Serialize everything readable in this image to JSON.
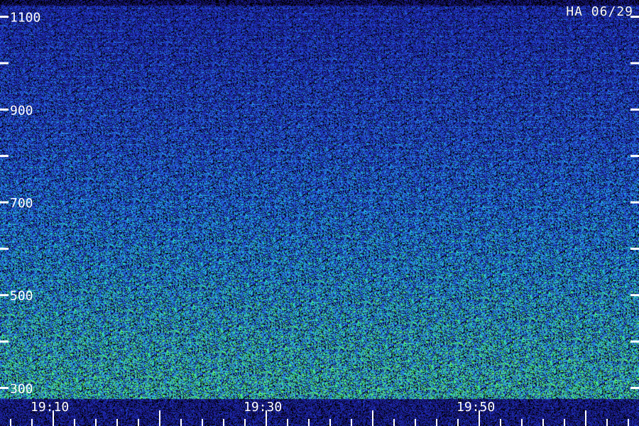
{
  "station_label": "HA 06/29",
  "chart_data": {
    "type": "heatmap",
    "title": "",
    "xlabel": "",
    "ylabel": "",
    "x_tick_labels": [
      "19:10",
      "19:30",
      "19:50"
    ],
    "x_ticks_minutes": [
      10,
      30,
      50
    ],
    "x_range_minutes": [
      5,
      65
    ],
    "x_minor_step_minutes": 2,
    "x_label_every_minutes": 20,
    "y_tick_labels": [
      "1100",
      "900",
      "700",
      "500",
      "300"
    ],
    "y_tick_values": [
      1100,
      900,
      700,
      500,
      300
    ],
    "y_range": [
      270,
      1130
    ],
    "y_minor_step": 100,
    "palette": [
      "#000000",
      "#1a1a8c",
      "#2040d0",
      "#2a80e8",
      "#20c0e0",
      "#30e0a0",
      "#60f060"
    ],
    "grid": false
  }
}
